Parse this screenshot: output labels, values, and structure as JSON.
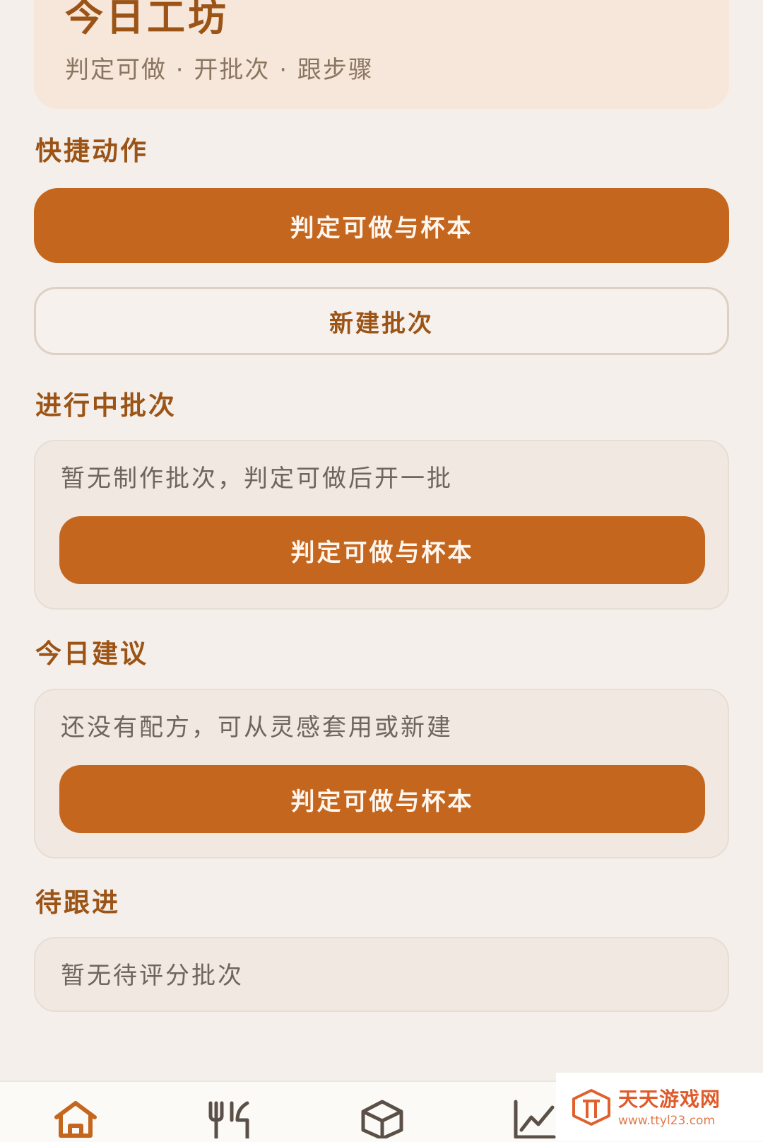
{
  "hero": {
    "title": "今日工坊",
    "subtitle": "判定可做 · 开批次 · 跟步骤"
  },
  "quick_actions": {
    "title": "快捷动作",
    "primary_label": "判定可做与杯本",
    "secondary_label": "新建批次"
  },
  "in_progress": {
    "title": "进行中批次",
    "empty_text": "暂无制作批次，判定可做后开一批",
    "action_label": "判定可做与杯本"
  },
  "suggestions": {
    "title": "今日建议",
    "empty_text": "还没有配方，可从灵感套用或新建",
    "action_label": "判定可做与杯本"
  },
  "follow_up": {
    "title": "待跟进",
    "empty_text": "暂无待评分批次"
  },
  "bottom_nav": {
    "items": [
      {
        "icon": "home-icon",
        "active": true
      },
      {
        "icon": "fork-knife-icon",
        "active": false
      },
      {
        "icon": "box-icon",
        "active": false
      },
      {
        "icon": "chart-icon",
        "active": false
      }
    ]
  },
  "watermark": {
    "name": "天天游戏网",
    "url": "www.ttyl23.com"
  },
  "colors": {
    "accent": "#c4661e",
    "heading": "#9b5416",
    "background": "#f4efea",
    "hero_background": "#f6e7da",
    "card_background": "#f0e8e1"
  }
}
